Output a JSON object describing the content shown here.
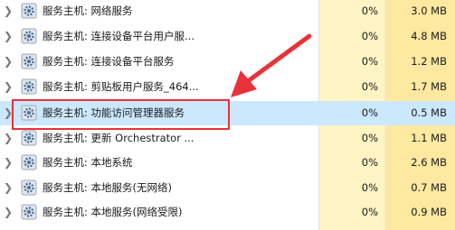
{
  "processes": [
    {
      "name": "服务主机: 网络服务",
      "cpu": "0%",
      "memory": "3.0 MB"
    },
    {
      "name": "服务主机: 连接设备平台用户服...",
      "cpu": "0%",
      "memory": "4.8 MB"
    },
    {
      "name": "服务主机: 连接设备平台服务",
      "cpu": "0%",
      "memory": "1.2 MB"
    },
    {
      "name": "服务主机: 剪贴板用户服务_464...",
      "cpu": "0%",
      "memory": "1.7 MB"
    },
    {
      "name": "服务主机: 功能访问管理器服务",
      "cpu": "0%",
      "memory": "0.5 MB",
      "selected": true
    },
    {
      "name": "服务主机: 更新 Orchestrator ...",
      "cpu": "0%",
      "memory": "1.1 MB"
    },
    {
      "name": "服务主机: 本地系统",
      "cpu": "0%",
      "memory": "2.6 MB"
    },
    {
      "name": "服务主机: 本地服务(无网络)",
      "cpu": "0%",
      "memory": "0.7 MB"
    },
    {
      "name": "服务主机: 本地服务(网络受限)",
      "cpu": "0%",
      "memory": "0.9 MB"
    }
  ],
  "colors": {
    "selected_row": "#cce8ff",
    "cpu_column": "#fff4c4",
    "memory_column": "#ffe9a0",
    "annotation": "#e8323a"
  },
  "icons": {
    "expand": "chevron-right-icon",
    "process": "gear-icon"
  }
}
